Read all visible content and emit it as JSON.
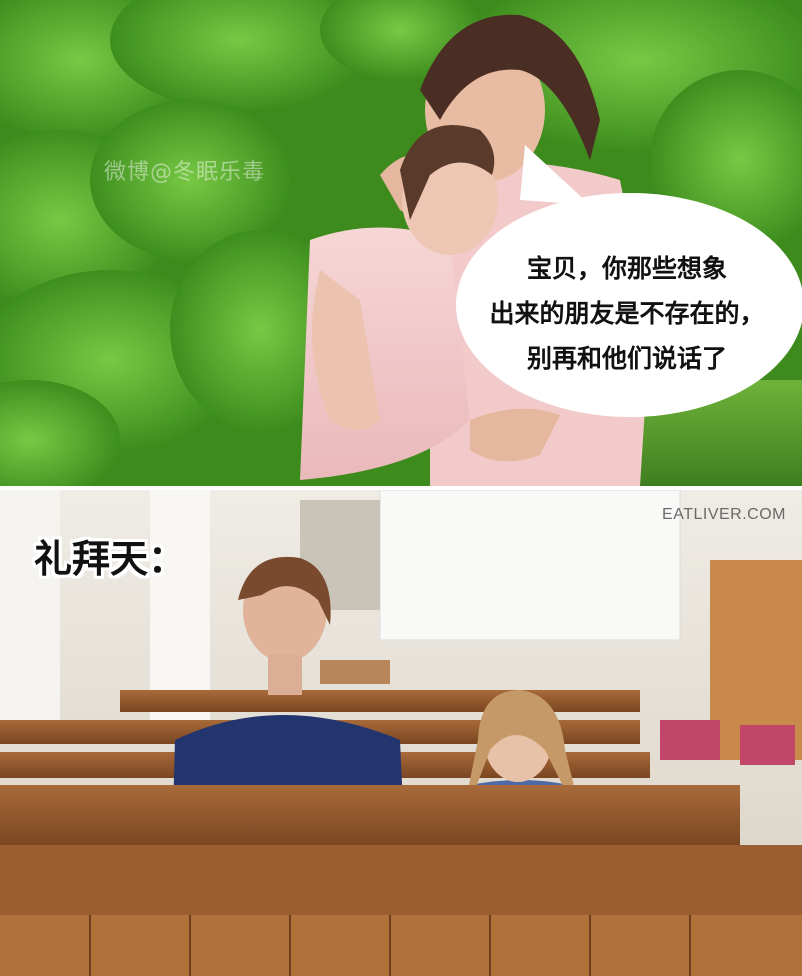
{
  "top_panel": {
    "watermark": "微博@冬眠乐毒",
    "speech_bubble": {
      "lines": [
        "宝贝，你那些想象",
        "出来的朋友是不存在的，",
        "别再和他们说话了"
      ]
    }
  },
  "bottom_panel": {
    "caption": "礼拜天：",
    "watermark": "EATLIVER.COM"
  }
}
